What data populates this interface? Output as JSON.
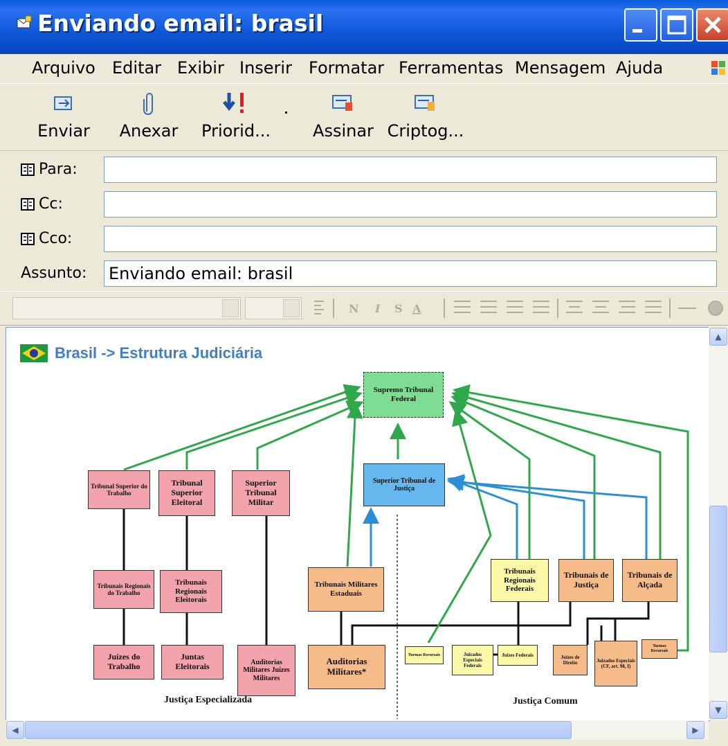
{
  "window": {
    "title": "Enviando email: brasil"
  },
  "menu": [
    "Arquivo",
    "Editar",
    "Exibir",
    "Inserir",
    "Formatar",
    "Ferramentas",
    "Mensagem",
    "Ajuda"
  ],
  "toolbar": {
    "send": "Enviar",
    "attach": "Anexar",
    "priority": "Priorid...",
    "sign": "Assinar",
    "encrypt": "Criptog..."
  },
  "fields": {
    "to_label": "Para:",
    "to_value": "",
    "cc_label": "Cc:",
    "cc_value": "",
    "bcc_label": "Cco:",
    "bcc_value": "",
    "subject_label": "Assunto:",
    "subject_value": "Enviando email: brasil"
  },
  "body": {
    "heading": "Brasil -> Estrutura Judiciária",
    "diagram": {
      "stf": "Supremo Tribunal Federal",
      "stj": "Superior Tribunal de Justiça",
      "tst": "Tribunal Superior do Trabalho",
      "tse": "Tribunal Superior Eleitoral",
      "stm": "Superior Tribunal Militar",
      "trt": "Tribunais Regionais do Trabalho",
      "tre": "Tribunais Regionais Eleitorais",
      "jt": "Juízes do Trabalho",
      "je": "Juntas Eleitorais",
      "am": "Auditorias Militares Juízes Militares",
      "tme": "Tribunais Militares Estaduais",
      "ame": "Auditorias Militares*",
      "trf": "Tribunais Regionais Federais",
      "tj": "Tribunais de Justiça",
      "ta": "Tribunais de Alçada",
      "te": "Turmas Recursais",
      "jef": "Juizados Especiais Federais",
      "jf": "Juízes Federais",
      "jd": "Juízes de Direito",
      "jesp": "Juizados Especiais (CF, art. 98, I)",
      "tr": "Turmas Recursais",
      "caption_left": "Justiça Especializada",
      "caption_right": "Justiça Comum"
    }
  },
  "colors": {
    "title_bar": "#0a5bdc",
    "heading": "#3f7fc2",
    "arrow_green": "#2ea84a",
    "arrow_blue": "#2b8fd8"
  }
}
